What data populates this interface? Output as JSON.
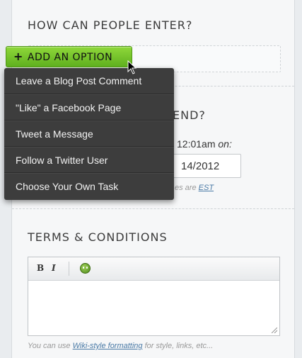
{
  "sections": {
    "enter_title": "HOW CAN PEOPLE ENTER?",
    "end_title_partial": "END?",
    "end_time": "12:01am",
    "end_on": "on:",
    "end_date": "14/2012",
    "timezone_prefix": "es are",
    "timezone_link": "EST",
    "terms_title": "TERMS & CONDITIONS"
  },
  "add_option": {
    "label": "ADD AN OPTION",
    "icon": "plus-icon",
    "color": "#6dbf25"
  },
  "dropdown": {
    "items": [
      "Leave a Blog Post Comment",
      "\"Like\" a Facebook Page",
      "Tweet a Message",
      "Follow a Twitter User",
      "Choose Your Own Task"
    ]
  },
  "editor": {
    "bold_label": "B",
    "italic_label": "I",
    "emoji_icon": "smiley-icon",
    "value": ""
  },
  "footer": {
    "prefix": "You can use",
    "link": "Wiki-style formatting",
    "suffix": "for style, links, etc..."
  }
}
